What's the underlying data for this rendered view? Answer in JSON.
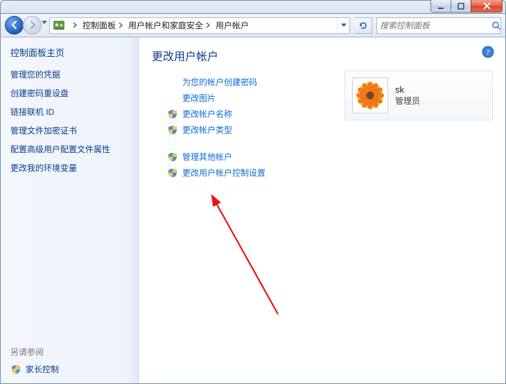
{
  "window_controls": {
    "minimize_tooltip": "最小化",
    "maximize_tooltip": "最大化",
    "close_tooltip": "关闭"
  },
  "breadcrumb": {
    "items": [
      "控制面板",
      "用户帐户和家庭安全",
      "用户帐户"
    ]
  },
  "search": {
    "placeholder": "搜索控制面板"
  },
  "sidebar": {
    "title": "控制面板主页",
    "links": [
      "管理您的凭据",
      "创建密码重设盘",
      "链接联机 ID",
      "管理文件加密证书",
      "配置高级用户配置文件属性",
      "更改我的环境变量"
    ],
    "see_also_label": "另请参阅",
    "see_also_item": "家长控制"
  },
  "content": {
    "heading": "更改用户帐户",
    "group1": [
      {
        "label": "为您的帐户创建密码",
        "shield": false
      },
      {
        "label": "更改图片",
        "shield": false
      },
      {
        "label": "更改帐户名称",
        "shield": true
      },
      {
        "label": "更改帐户类型",
        "shield": true
      }
    ],
    "group2": [
      {
        "label": "管理其他帐户",
        "shield": true
      },
      {
        "label": "更改用户帐户控制设置",
        "shield": true
      }
    ]
  },
  "account": {
    "name": "sk",
    "role": "管理员"
  }
}
